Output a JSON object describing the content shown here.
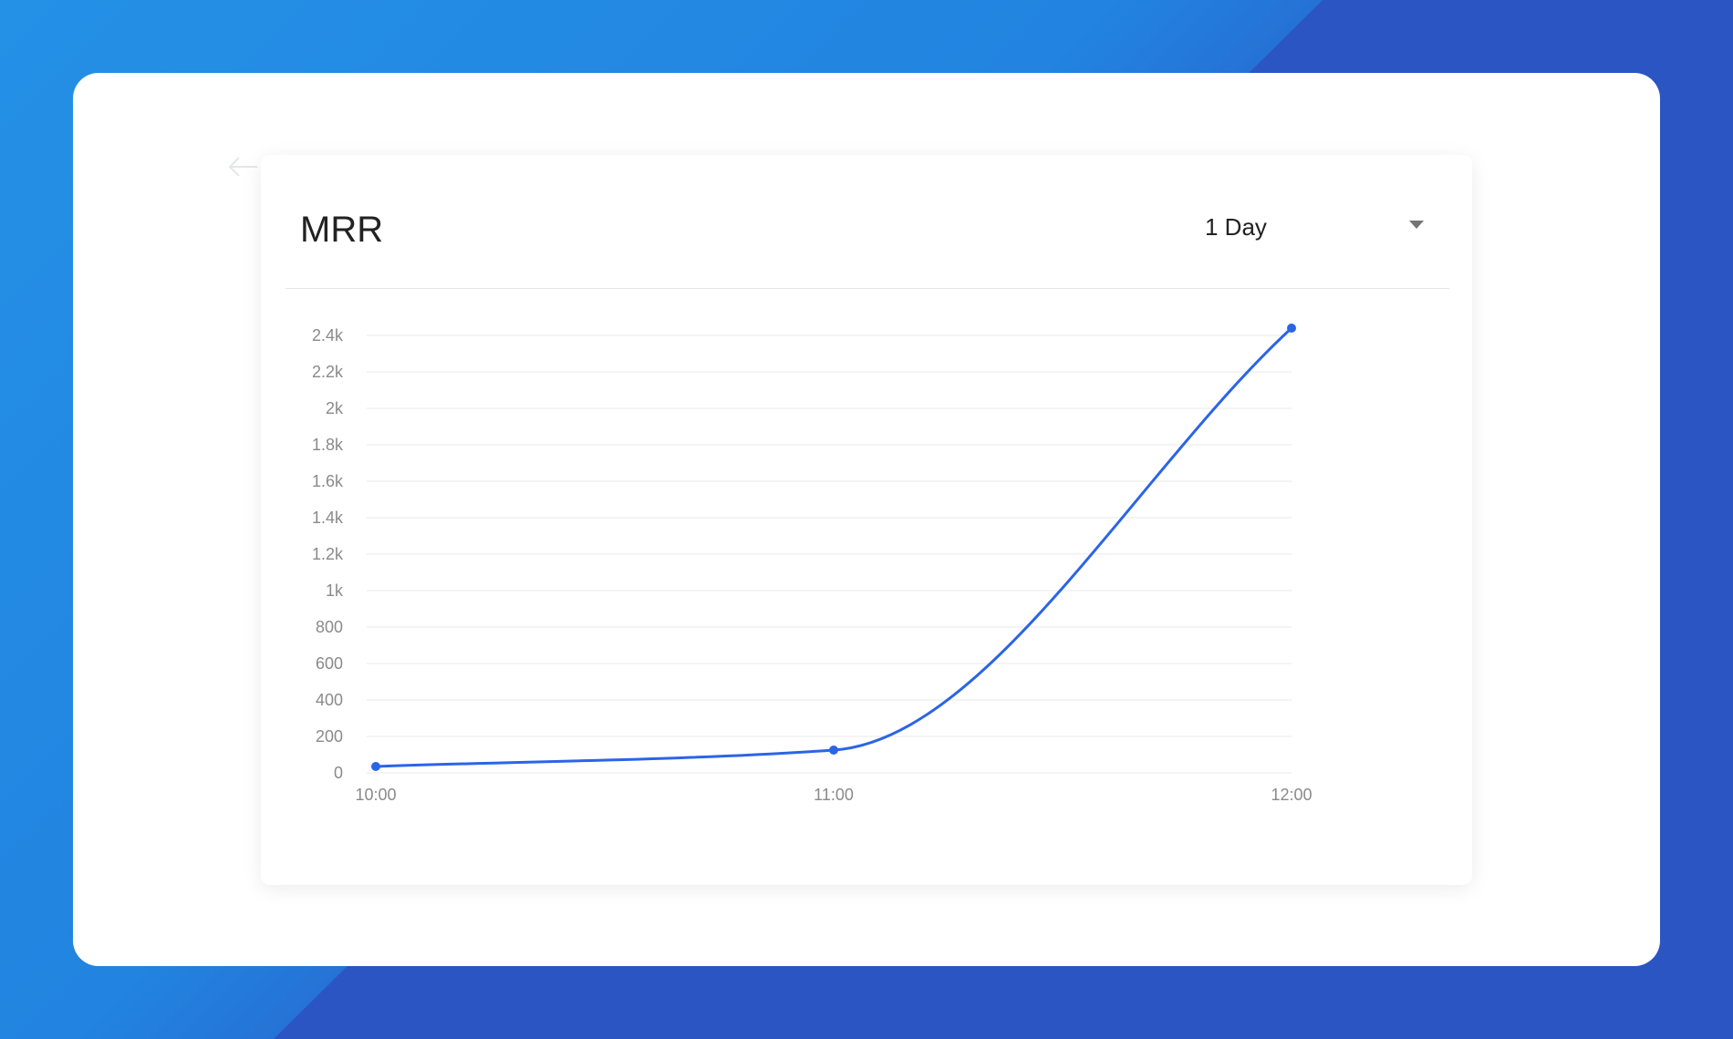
{
  "card": {
    "title": "MRR",
    "range_select": {
      "selected": "1 Day",
      "icon": "caret-down-icon"
    }
  },
  "colors": {
    "accent": "#2b65e6",
    "background_blue": "#2a55c3",
    "background_light_blue": "#2490e6",
    "grid": "#e9e9e9",
    "tick_text": "#8a8a8a"
  },
  "chart_data": {
    "type": "line",
    "x": [
      "10:00",
      "11:00",
      "12:00"
    ],
    "series": [
      {
        "values": [
          35,
          125,
          2440
        ]
      }
    ],
    "y_ticks": [
      0,
      200,
      400,
      600,
      800,
      1000,
      1200,
      1400,
      1600,
      1800,
      2000,
      2200,
      2400
    ],
    "y_tick_labels": [
      "0",
      "200",
      "400",
      "600",
      "800",
      "1k",
      "1.2k",
      "1.4k",
      "1.6k",
      "1.8k",
      "2k",
      "2.2k",
      "2.4k"
    ],
    "ylim": [
      0,
      2400
    ],
    "grid": true,
    "legend": false,
    "smooth": true,
    "markers": true
  }
}
